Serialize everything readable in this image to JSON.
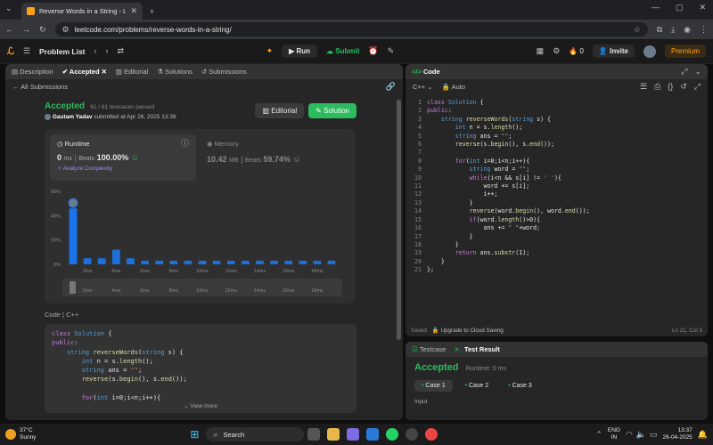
{
  "browser": {
    "tab_title": "Reverse Words in a String - Lee",
    "url": "leetcode.com/problems/reverse-words-in-a-string/"
  },
  "topbar": {
    "problem_list": "Problem List",
    "run": "Run",
    "submit": "Submit",
    "streak": "0",
    "invite": "Invite",
    "premium": "Premium"
  },
  "left_tabs": [
    "Description",
    "Accepted",
    "Editorial",
    "Solutions",
    "Submissions"
  ],
  "all_submissions": "All Submissions",
  "result": {
    "status": "Accepted",
    "passed": "61 / 61 testcases passed",
    "user": "Gautam Yadav",
    "submitted": "submitted at Apr 26, 2025 13:36",
    "editorial_btn": "Editorial",
    "solution_btn": "Solution"
  },
  "runtime": {
    "label": "Runtime",
    "value": "0",
    "unit": "ms",
    "beats_label": "Beats",
    "beats": "100.00%",
    "analyze": "Analyze Complexity"
  },
  "memory": {
    "label": "Memory",
    "value": "10.42",
    "unit": "MB",
    "beats_label": "Beats",
    "beats": "59.74%"
  },
  "chart_data": {
    "type": "bar",
    "y_ticks": [
      "60%",
      "40%",
      "20%",
      "0%"
    ],
    "ylim": [
      0,
      60
    ],
    "x_labels": [
      "2ms",
      "4ms",
      "6ms",
      "8ms",
      "10ms",
      "12ms",
      "14ms",
      "16ms",
      "18ms"
    ],
    "values": [
      46,
      5,
      5,
      12,
      5,
      3,
      3,
      3,
      3,
      3,
      3,
      3,
      3,
      3,
      3,
      3,
      3,
      3,
      3
    ]
  },
  "code_section": {
    "label": "Code",
    "lang": "C++",
    "view_more": "View more",
    "lines": [
      "class Solution {",
      "public:",
      "    string reverseWords(string s) {",
      "        int n = s.length();",
      "        string ans = \"\";",
      "        reverse(s.begin(), s.end());",
      "",
      "        for(int i=0;i<n;i++){"
    ]
  },
  "editor": {
    "title": "Code",
    "lang": "C++",
    "auto": "Auto",
    "status_left": "Saved",
    "upgrade": "Upgrade to Cloud Saving",
    "position": "Ln 21, Col 3"
  },
  "editor_lines": [
    "class Solution {",
    "public:",
    "    string reverseWords(string s) {",
    "        int n = s.length();",
    "        string ans = \"\";",
    "        reverse(s.begin(), s.end());",
    "",
    "        for(int i=0;i<n;i++){",
    "            string word = \"\";",
    "            while(i<n && s[i] != ' '){",
    "                word += s[i];",
    "                i++;",
    "            }",
    "            reverse(word.begin(), word.end());",
    "            if(word.length()>0){",
    "                ans += \" \"+word;",
    "            }",
    "        }",
    "        return ans.substr(1);",
    "    }",
    "};"
  ],
  "testpanel": {
    "tab1": "Testcase",
    "tab2": "Test Result",
    "status": "Accepted",
    "runtime": "Runtime: 0 ms",
    "cases": [
      "Case 1",
      "Case 2",
      "Case 3"
    ],
    "input_label": "Input"
  },
  "taskbar": {
    "temp": "37°C",
    "weather": "Sunny",
    "search": "Search",
    "lang1": "ENG",
    "lang2": "IN",
    "time": "13:37",
    "date": "26-04-2025"
  }
}
